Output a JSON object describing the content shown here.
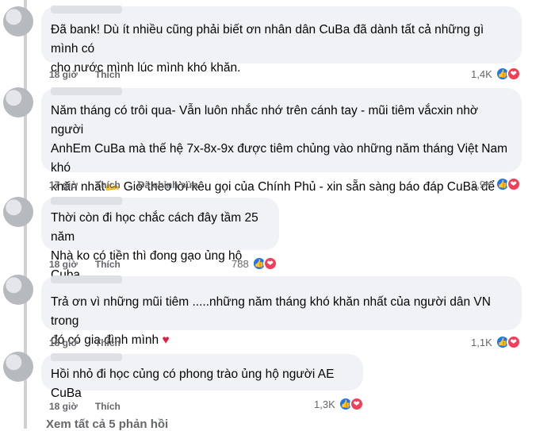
{
  "comments": [
    {
      "text": "Đã bank! Dù ít nhiều cũng phải biết ơn nhân dân CuBa đã dành tất cả những gì mình có\ncho nước mình lúc mình khó khăn.",
      "time": "18 giờ",
      "like_label": "Thích",
      "edited_label": "",
      "reaction_count": "1,4K"
    },
    {
      "text": "Năm tháng có trôi qua- Vẫn luôn nhắc nhớ trên cánh tay - mũi tiêm vắcxin nhờ người\nAnhEm CuBa mà thế hệ 7x-8x-9x được tiêm chủng vào những năm tháng Việt Nam khó\nkhăn nhất🫴 Giờ theo lời kêu gọi của Chính Phủ - xin sẵn sàng báo đáp CuBa để nghĩa\ntình được đáp đền tiếp nối",
      "time": "17 giờ",
      "like_label": "Thích",
      "edited_label": "Đã chỉnh sửa",
      "reaction_count": "2,9K"
    },
    {
      "text": "Thời còn đi học chắc cách đây tầm 25 năm\nNhà ko có tiền thì đong gạo ủng hộ Cuba",
      "time": "18 giờ",
      "like_label": "Thích",
      "edited_label": "",
      "reaction_count": "788"
    },
    {
      "text": "Trả ơn vì những mũi tiêm .....những năm tháng khó khăn nhất của người dân VN trong\nđó có gia đình mình",
      "time": "18 giờ",
      "like_label": "Thích",
      "edited_label": "",
      "reaction_count": "1,1K"
    },
    {
      "text": "Hồi nhỏ đi học củng có phong trào ủng hộ người AE CuBa",
      "time": "18 giờ",
      "like_label": "Thích",
      "edited_label": "",
      "reaction_count": "1,3K"
    }
  ],
  "see_all_replies": "Xem tất cả 5 phản hồi",
  "heart_glyph": "♥",
  "colors": {
    "like": "#1877f2",
    "love": "#f33e58",
    "bubble": "#f0f2f5",
    "meta": "#65676b"
  }
}
